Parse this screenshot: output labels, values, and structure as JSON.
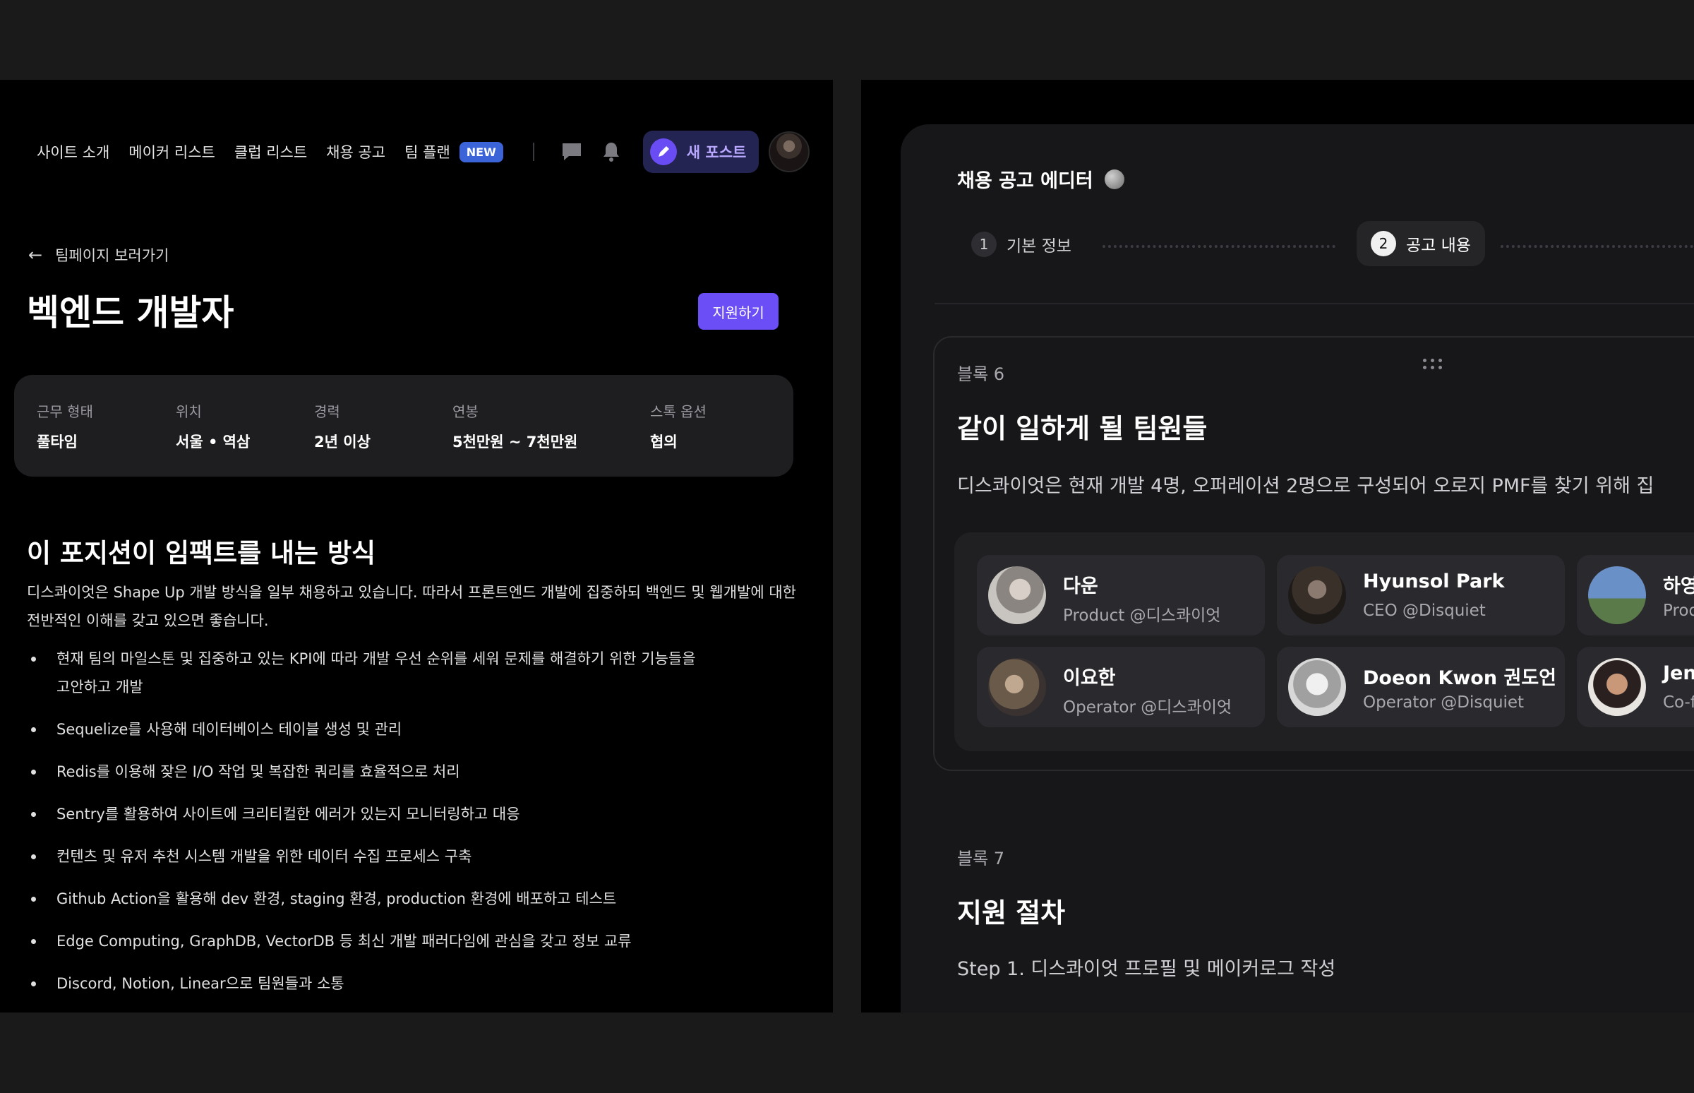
{
  "nav": {
    "items": [
      "사이트 소개",
      "메이커 리스트",
      "클럽 리스트",
      "채용 공고",
      "팀 플랜"
    ],
    "new_badge": "NEW",
    "new_post_label": "새 포스트"
  },
  "job": {
    "back_label": "팀페이지 보러가기",
    "title": "벡엔드 개발자",
    "apply_label": "지원하기",
    "info": [
      {
        "label": "근무 형태",
        "value": "풀타임"
      },
      {
        "label": "위치",
        "value": "서울 • 역삼"
      },
      {
        "label": "경력",
        "value": "2년 이상"
      },
      {
        "label": "연봉",
        "value": "5천만원 ~ 7천만원"
      },
      {
        "label": "스톡 옵션",
        "value": "협의"
      }
    ],
    "section_title": "이 포지션이 임팩트를 내는 방식",
    "section_desc": "디스콰이엇은 Shape Up 개발 방식을 일부 채용하고 있습니다. 따라서 프론트엔드 개발에 집중하되 백엔드 및 웹개발에 대한 전반적인 이해를 갖고 있으면 좋습니다.",
    "bullets": [
      "현재 팀의 마일스톤 및 집중하고 있는 KPI에 따라 개발 우선 순위를 세워 문제를 해결하기 위한 기능들을 고안하고 개발",
      "Sequelize를 사용해 데이터베이스 테이블 생성 및 관리",
      "Redis를 이용해 잦은 I/O 작업 및 복잡한 쿼리를 효율적으로 처리",
      "Sentry를 활용하여 사이트에 크리티컬한 에러가 있는지 모니터링하고 대응",
      "컨텐츠 및 유저 추천 시스템 개발을 위한 데이터 수집 프로세스 구축",
      "Github Action을 활용해 dev 환경, staging 환경, production 환경에 배포하고 테스트",
      "Edge Computing, GraphDB, VectorDB 등 최신 개발 패러다임에 관심을 갖고 정보 교류",
      "Discord, Notion, Linear으로 팀원들과 소통"
    ]
  },
  "editor": {
    "title": "채용 공고 에디터",
    "steps": [
      {
        "num": "1",
        "label": "기본 정보"
      },
      {
        "num": "2",
        "label": "공고 내용"
      }
    ],
    "block6": {
      "label": "블록 6",
      "title": "같이 일하게 될 팀원들",
      "desc": "디스콰이엇은 현재 개발 4명, 오퍼레이션 2명으로 구성되어 오로지 PMF를 찾기 위해 집"
    },
    "members": [
      {
        "name": "다운",
        "role": "Product @디스콰이엇"
      },
      {
        "name": "Hyunsol Park",
        "role": "CEO @Disquiet"
      },
      {
        "name": "하영",
        "role": "Prod"
      },
      {
        "name": "이요한",
        "role": "Operator @디스콰이엇"
      },
      {
        "name": "Doeon Kwon 권도언",
        "role": "Operator @Disquiet"
      },
      {
        "name": "Jen",
        "role": "Co-f"
      }
    ],
    "block7": {
      "label": "블록 7",
      "title": "지원 절차",
      "desc": "Step 1. 디스콰이엇 프로필 및 메이커로그 작성"
    }
  },
  "colors": {
    "accent": "#6b4ef5",
    "badge": "#3a64d8",
    "background": "#000000"
  }
}
